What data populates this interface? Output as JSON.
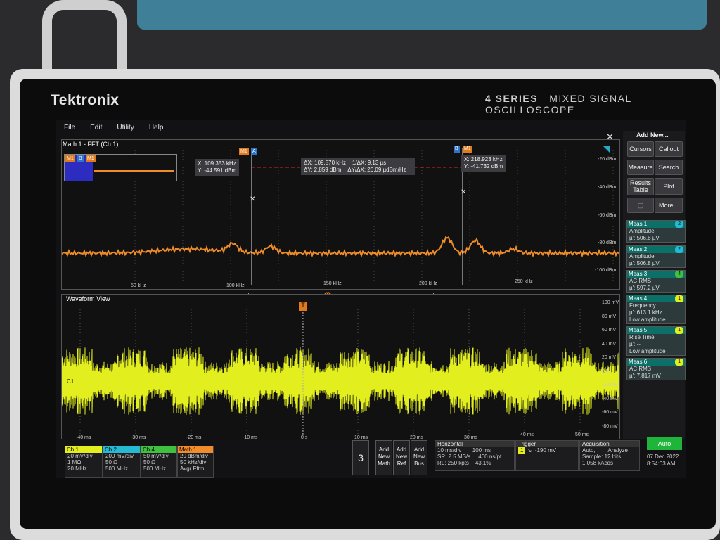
{
  "brand": "Tektronix",
  "series_bold": "4 SERIES",
  "series_rest": "MIXED SIGNAL OSCILLOSCOPE",
  "menu": [
    "File",
    "Edit",
    "Utility",
    "Help"
  ],
  "fft": {
    "title": "Math 1 - FFT (Ch 1)",
    "x_ticks": [
      "50 kHz",
      "100 kHz",
      "150 kHz",
      "200 kHz",
      "250 kHz"
    ],
    "y_ticks": [
      "-20 dBm",
      "-40 dBm",
      "-60 dBm",
      "-80 dBm",
      "-100 dBm"
    ],
    "cursor_a": {
      "x": "X: 109.353 kHz",
      "y": "Y: -44.591 dBm",
      "tag": "A"
    },
    "cursor_b": {
      "x": "X: 218.923 kHz",
      "y": "Y: -41.732 dBm",
      "tag": "B"
    },
    "delta": {
      "dx": "ΔX: 109.570 kHz",
      "inv": "1/ΔX: 9.13 µs",
      "dy": "ΔY: 2.859 dBm",
      "ratio": "ΔY/ΔX: 26.09 µdBm/Hz"
    },
    "m1": "M1"
  },
  "wave": {
    "title": "Waveform View",
    "x_ticks": [
      "-40 ms",
      "-30 ms",
      "-20 ms",
      "-10 ms",
      "0 s",
      "10 ms",
      "20 ms",
      "30 ms",
      "40 ms",
      "50 ms"
    ],
    "y_ticks": [
      "100 mV",
      "80 mV",
      "60 mV",
      "40 mV",
      "20 mV",
      "0 V",
      "-20 mV",
      "-40 mV",
      "-60 mV",
      "-80 mV"
    ],
    "c1": "C1",
    "trig": "T"
  },
  "right_panel": {
    "add_new": "Add New...",
    "buttons": [
      "Cursors",
      "Callout",
      "Measure",
      "Search",
      "Results Table",
      "Plot",
      "More..."
    ],
    "measurements": [
      {
        "head": "Meas 1",
        "badge": "2",
        "name": "Amplitude",
        "value": "µ': 506.8 µV",
        "extra": ""
      },
      {
        "head": "Meas 2",
        "badge": "2",
        "name": "Amplitude",
        "value": "µ': 506.8 µV",
        "extra": ""
      },
      {
        "head": "Meas 3",
        "badge": "4",
        "name": "AC RMS",
        "value": "µ': 597.2 µV",
        "extra": ""
      },
      {
        "head": "Meas 4",
        "badge": "1",
        "name": "Frequency",
        "value": "µ': 613.1 kHz",
        "extra": "Low amplitude"
      },
      {
        "head": "Meas 5",
        "badge": "1",
        "name": "Rise Time",
        "value": "µ': --",
        "extra": "Low amplitude"
      },
      {
        "head": "Meas 6",
        "badge": "1",
        "name": "AC RMS",
        "value": "µ': 7.817 mV",
        "extra": ""
      }
    ]
  },
  "bottom": {
    "ch1": {
      "h": "Ch 1",
      "l1": "20 mV/div",
      "l2": "1 MΩ",
      "l3": "20 MHz"
    },
    "ch2": {
      "h": "Ch 2",
      "l1": "200 mV/div",
      "l2": "50 Ω",
      "l3": "500 MHz"
    },
    "ch4": {
      "h": "Ch 4",
      "l1": "50 mV/div",
      "l2": "50 Ω",
      "l3": "500 MHz"
    },
    "math1": {
      "h": "Math 1",
      "l1": "20 dBm/div",
      "l2": "50 kHz/div",
      "l3": "Avg( Fftm..."
    },
    "count": "3",
    "add_math": "Add New Math",
    "add_ref": "Add New Ref",
    "add_bus": "Add New Bus",
    "horizontal": {
      "h": "Horizontal",
      "a": "10 ms/div",
      "b": "100 ms",
      "c": "SR: 2.5 MS/s",
      "d": "400 ns/pt",
      "e": "RL: 250 kpts",
      "f": "43.1%"
    },
    "trigger": {
      "h": "Trigger",
      "src": "1",
      "level": "-190 mV"
    },
    "acquisition": {
      "h": "Acquisition",
      "a": "Auto,",
      "b": "Analyze",
      "c": "Sample: 12 bits",
      "d": "1.058 kAcqs"
    },
    "auto": "Auto",
    "date": "07 Dec 2022",
    "time": "8:54:03 AM"
  },
  "colors": {
    "fft_trace": "#f08c2a",
    "wave_trace": "#e3ee1e",
    "meas_head": "#0b7168",
    "auto_btn": "#1fb53a"
  }
}
